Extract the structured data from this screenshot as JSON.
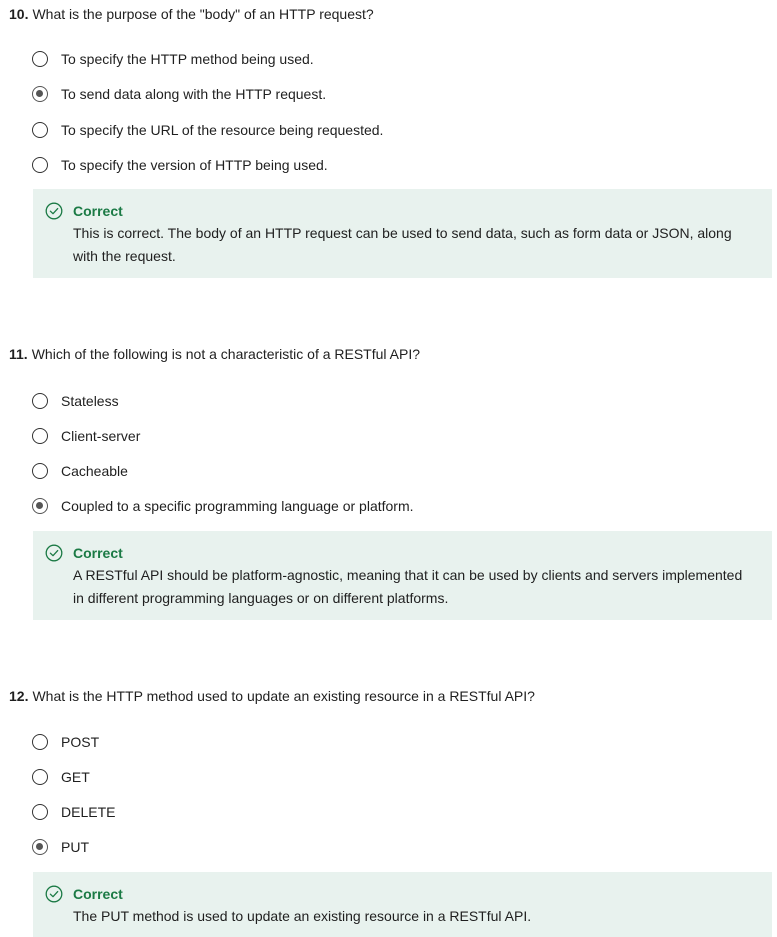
{
  "questions": [
    {
      "number": "10.",
      "text": "What is the purpose of the \"body\" of an HTTP request?",
      "options": [
        {
          "label": "To specify the HTTP method being used.",
          "selected": false
        },
        {
          "label": "To send data along with the HTTP request.",
          "selected": true
        },
        {
          "label": "To specify the URL of the resource being requested.",
          "selected": false
        },
        {
          "label": "To specify the version of HTTP being used.",
          "selected": false
        }
      ],
      "feedback": {
        "status": "Correct",
        "icon": "check-circle-icon",
        "text": "This is correct. The body of an HTTP request can be used to send data, such as form data or JSON, along with the request."
      }
    },
    {
      "number": "11.",
      "text": "Which of the following is not a characteristic of a RESTful API?",
      "options": [
        {
          "label": "Stateless",
          "selected": false
        },
        {
          "label": "Client-server",
          "selected": false
        },
        {
          "label": "Cacheable",
          "selected": false
        },
        {
          "label": "Coupled to a specific programming language or platform.",
          "selected": true
        }
      ],
      "feedback": {
        "status": "Correct",
        "icon": "check-circle-icon",
        "text": "A RESTful API should be platform-agnostic, meaning that it can be used by clients and servers implemented in different programming languages or on different platforms."
      }
    },
    {
      "number": "12.",
      "text": "What is the HTTP method used to update an existing resource in a RESTful API?",
      "options": [
        {
          "label": "POST",
          "selected": false
        },
        {
          "label": "GET",
          "selected": false
        },
        {
          "label": "DELETE",
          "selected": false
        },
        {
          "label": "PUT",
          "selected": true
        }
      ],
      "feedback": {
        "status": "Correct",
        "icon": "check-circle-icon",
        "text": "The PUT method is used to update an existing resource in a RESTful API."
      }
    }
  ],
  "colors": {
    "correct_green": "#1b7a45",
    "feedback_background": "#e8f2ee",
    "radio_border": "#333333",
    "radio_selected_dot": "#555555"
  }
}
